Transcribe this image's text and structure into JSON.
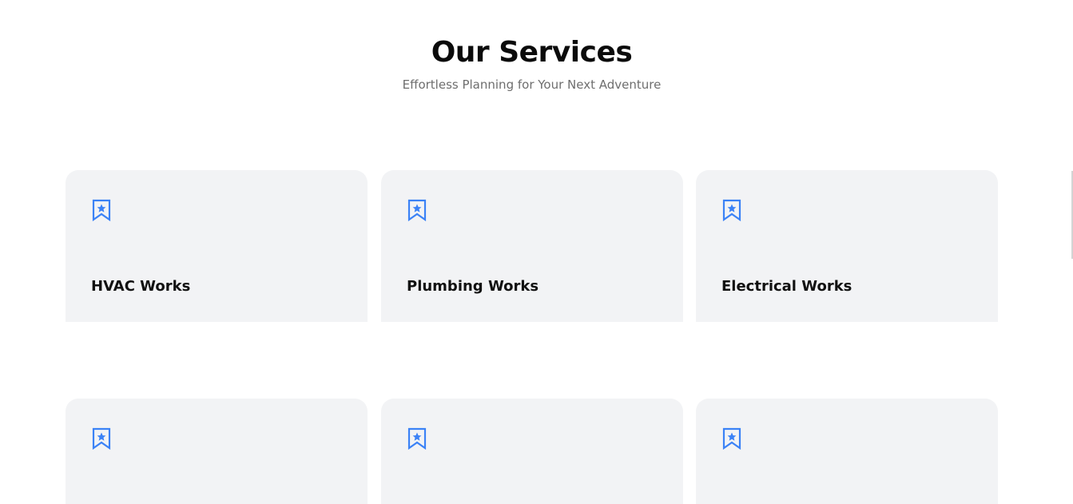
{
  "header": {
    "title": "Our Services",
    "subtitle": "Effortless Planning for Your Next Adventure"
  },
  "services": [
    {
      "title": "HVAC Works",
      "icon": "bookmark-star-icon"
    },
    {
      "title": "Plumbing Works",
      "icon": "bookmark-star-icon"
    },
    {
      "title": "Electrical Works",
      "icon": "bookmark-star-icon"
    },
    {
      "title": "",
      "icon": "bookmark-star-icon"
    },
    {
      "title": "",
      "icon": "bookmark-star-icon"
    },
    {
      "title": "",
      "icon": "bookmark-star-icon"
    }
  ],
  "colors": {
    "accent": "#3b82f6",
    "card_background": "#f2f3f5",
    "heading": "#0b0b0b",
    "subtitle": "#6e6e6e"
  }
}
